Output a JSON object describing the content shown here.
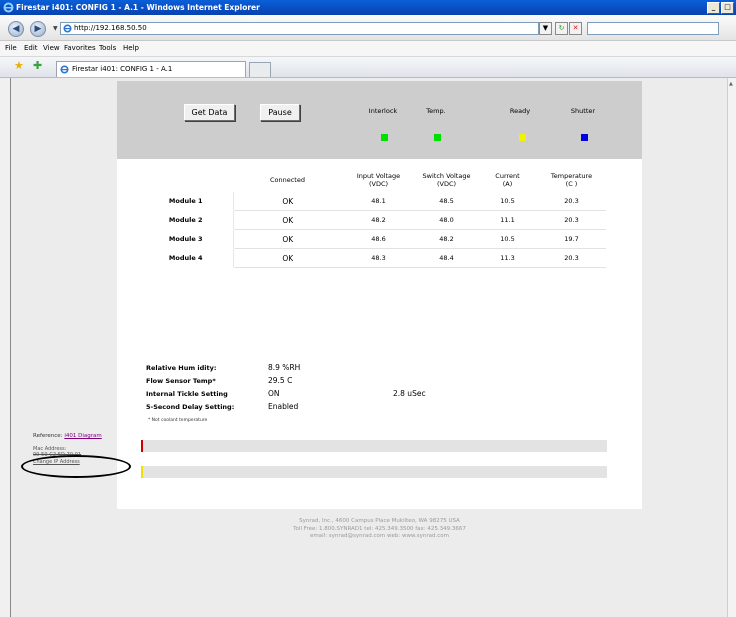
{
  "window": {
    "title": "Firestar i401: CONFIG 1 - A.1 - Windows Internet Explorer",
    "min": "_",
    "max": "□",
    "close": "×"
  },
  "address": {
    "url": "http://192.168.50.50",
    "search_placeholder": ""
  },
  "menu": {
    "file": "File",
    "edit": "Edit",
    "view": "View",
    "favorites": "Favorites",
    "tools": "Tools",
    "help": "Help"
  },
  "tab": {
    "label": "Firestar i401: CONFIG 1 - A.1"
  },
  "controls": {
    "get_data": "Get Data",
    "pause": "Pause"
  },
  "status": {
    "interlock": {
      "label": "Interlock",
      "color": "#00e000"
    },
    "temp": {
      "label": "Temp.",
      "color": "#00e000"
    },
    "ready": {
      "label": "Ready",
      "color": "#f2f200"
    },
    "shutter": {
      "label": "Shutter",
      "color": "#0000e0"
    }
  },
  "table": {
    "headers": {
      "connected": "Connected",
      "input_voltage": "Input Voltage",
      "input_voltage_unit": "(VDC)",
      "switch_voltage": "Switch Voltage",
      "switch_voltage_unit": "(VDC)",
      "current": "Current",
      "current_unit": "(A)",
      "temperature": "Temperature",
      "temperature_unit": "(C )"
    },
    "rows": [
      {
        "name": "Module 1",
        "connected": "OK",
        "input": "48.1",
        "switch": "48.5",
        "current": "10.5",
        "temp": "20.3"
      },
      {
        "name": "Module 2",
        "connected": "OK",
        "input": "48.2",
        "switch": "48.0",
        "current": "11.1",
        "temp": "20.3"
      },
      {
        "name": "Module 3",
        "connected": "OK",
        "input": "48.6",
        "switch": "48.2",
        "current": "10.5",
        "temp": "19.7"
      },
      {
        "name": "Module 4",
        "connected": "OK",
        "input": "48.3",
        "switch": "48.4",
        "current": "11.3",
        "temp": "20.3"
      }
    ]
  },
  "info": {
    "humidity_label": "Relative Hum idity:",
    "humidity_value": "8.9 %RH",
    "flow_label": "Flow Sensor Temp*",
    "flow_value": "29.5 C",
    "tickle_label": "Internal Tickle Setting",
    "tickle_value": "ON",
    "tickle_extra": "2.8 uSec",
    "delay_label": "5-Second Delay Setting:",
    "delay_value": "Enabled",
    "footnote": "* Not coolant temperature"
  },
  "bars": {
    "red_color": "#cc0000",
    "yellow_color": "#f0e000"
  },
  "reference": {
    "prefix": "Reference:",
    "link": "i401 Diagram",
    "mac_label": "Mac Address:",
    "mac_value": "00-50-C2-5D-70-01",
    "change_ip": "Change IP Address"
  },
  "footer": {
    "line1": "Synrad, Inc., 4600 Campus Place Mukilteo, WA 98275 USA",
    "line2": "Toll Free: 1.800.SYNRAD1   tel: 425.349.3500   fax: 425.349.3667",
    "line3": "email: synrad@synrad.com   web: www.synrad.com"
  }
}
